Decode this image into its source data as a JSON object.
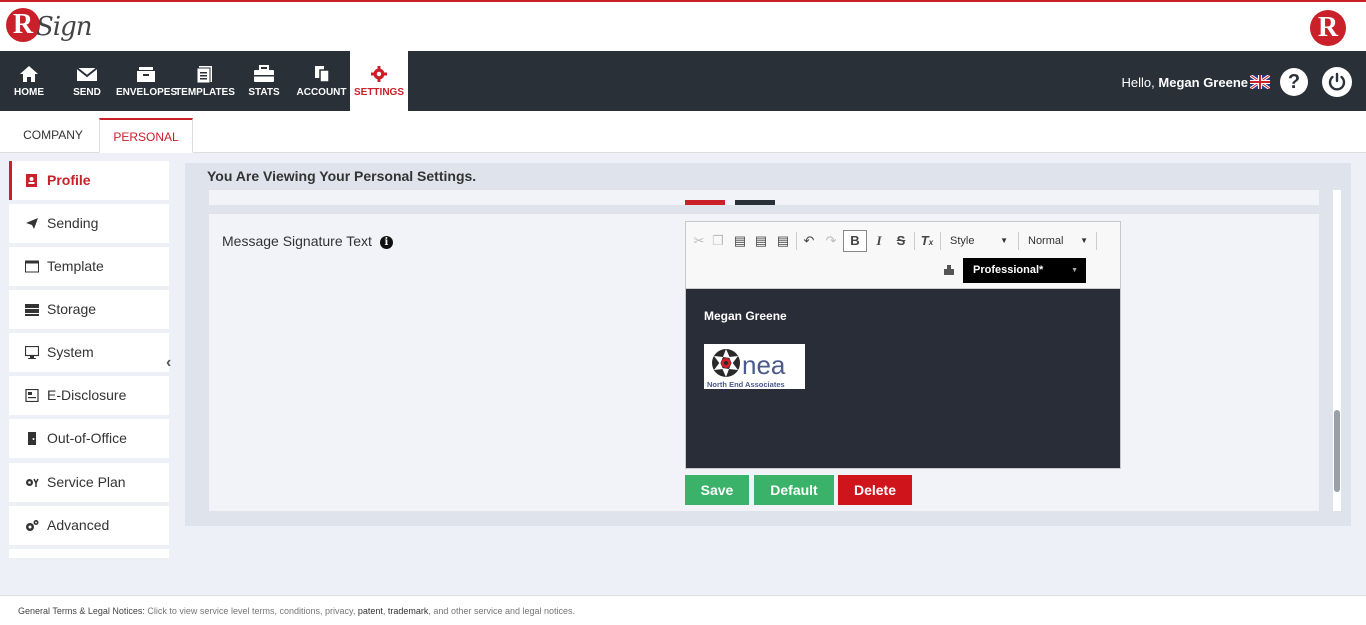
{
  "brand": {
    "logo_letter": "R",
    "logo_text": "Sign",
    "right_logo_letter": "R"
  },
  "nav": {
    "items": [
      {
        "label": "HOME",
        "icon": "home-icon"
      },
      {
        "label": "SEND",
        "icon": "envelope-icon"
      },
      {
        "label": "ENVELOPES",
        "icon": "inbox-icon"
      },
      {
        "label": "TEMPLATES",
        "icon": "templates-icon"
      },
      {
        "label": "STATS",
        "icon": "briefcase-icon"
      },
      {
        "label": "ACCOUNT",
        "icon": "account-icon"
      },
      {
        "label": "SETTINGS",
        "icon": "gear-icon"
      }
    ],
    "active": "SETTINGS",
    "hello_prefix": "Hello,",
    "user_name": "Megan Greene",
    "help_glyph": "?"
  },
  "subtabs": {
    "company": "COMPANY",
    "personal": "PERSONAL",
    "active": "PERSONAL"
  },
  "sidebar": {
    "items": [
      {
        "label": "Profile",
        "icon": "profile-icon"
      },
      {
        "label": "Sending",
        "icon": "paper-plane-icon"
      },
      {
        "label": "Template",
        "icon": "window-icon"
      },
      {
        "label": "Storage",
        "icon": "storage-icon"
      },
      {
        "label": "System",
        "icon": "monitor-icon"
      },
      {
        "label": "E-Disclosure",
        "icon": "document-icon"
      },
      {
        "label": "Out-of-Office",
        "icon": "door-icon"
      },
      {
        "label": "Service Plan",
        "icon": "service-plan-icon"
      },
      {
        "label": "Advanced",
        "icon": "gears-icon"
      }
    ],
    "active": "Profile",
    "collapse_glyph": "‹"
  },
  "main": {
    "title": "You Are Viewing Your Personal Settings.",
    "field_label": "Message Signature Text",
    "info_glyph": "i"
  },
  "editor": {
    "style_combo": "Style",
    "format_combo": "Normal",
    "font_select": "Professional*",
    "signature_name": "Megan Greene",
    "logo_text": "nea",
    "logo_subtext": "North End Associates"
  },
  "buttons": {
    "save": "Save",
    "default": "Default",
    "delete": "Delete"
  },
  "footer": {
    "label": "General Terms & Legal Notices:",
    "text_1": "Click to view service level terms, conditions, privacy,",
    "link_patent": "patent",
    "sep": ",",
    "link_trademark": "trademark",
    "text_2": ", and other service and legal notices."
  },
  "colors": {
    "brand_red": "#c9202a",
    "nav_bg": "#293038",
    "green": "#3bb26a",
    "delete_red": "#d0141c"
  }
}
